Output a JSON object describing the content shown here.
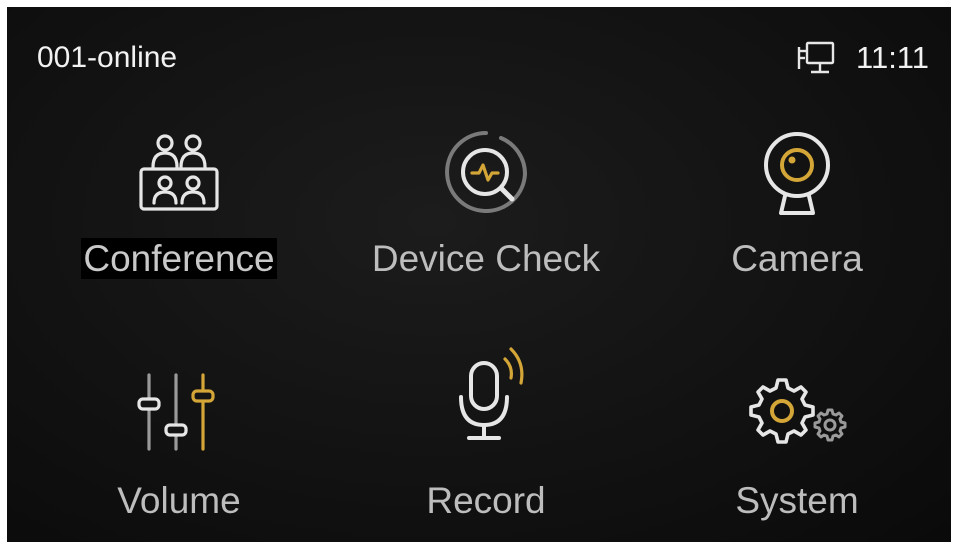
{
  "status_bar": {
    "device_status": "001-online",
    "network_icon": "network-monitor-icon",
    "time": "11:11"
  },
  "menu": {
    "items": [
      {
        "label": "Conference",
        "icon": "conference-icon",
        "selected": true
      },
      {
        "label": "Device Check",
        "icon": "device-check-icon",
        "selected": false
      },
      {
        "label": "Camera",
        "icon": "camera-icon",
        "selected": false
      },
      {
        "label": "Volume",
        "icon": "volume-sliders-icon",
        "selected": false
      },
      {
        "label": "Record",
        "icon": "microphone-icon",
        "selected": false
      },
      {
        "label": "System",
        "icon": "gears-icon",
        "selected": false
      }
    ]
  },
  "colors": {
    "accent": "#d4a537",
    "icon_stroke": "#e6e6e6",
    "label": "#bdbdbd",
    "background": "#141414"
  }
}
